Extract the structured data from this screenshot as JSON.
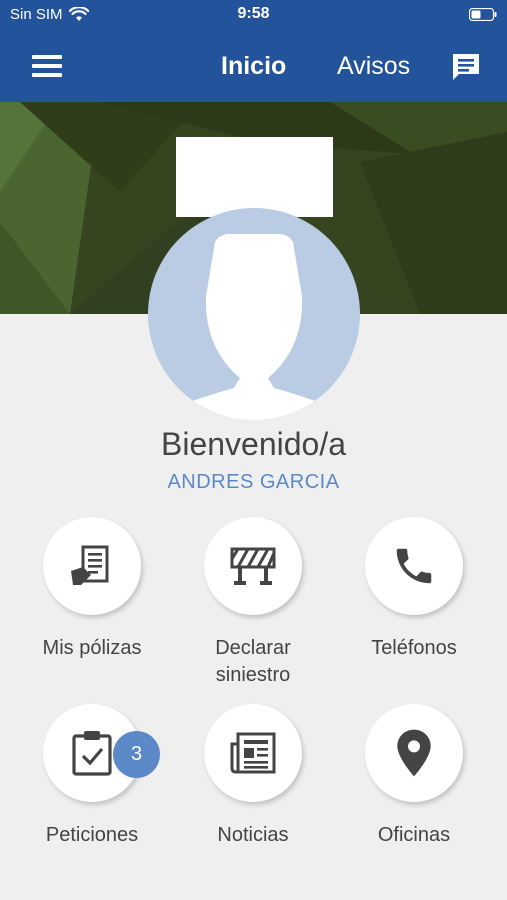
{
  "status_bar": {
    "carrier": "Sin SIM",
    "time": "9:58"
  },
  "nav": {
    "tab_home": "Inicio",
    "tab_notices": "Avisos"
  },
  "profile": {
    "greeting": "Bienvenido/a",
    "user_name": "ANDRES GARCIA"
  },
  "tiles": [
    {
      "label_1": "Mis pólizas",
      "label_2": "",
      "icon": "policy-document-icon"
    },
    {
      "label_1": "Declarar",
      "label_2": "siniestro",
      "icon": "road-barrier-icon"
    },
    {
      "label_1": "Teléfonos",
      "label_2": "",
      "icon": "phone-icon"
    },
    {
      "label_1": "Peticiones",
      "label_2": "",
      "icon": "clipboard-check-icon",
      "badge": "3"
    },
    {
      "label_1": "Noticias",
      "label_2": "",
      "icon": "newspaper-icon"
    },
    {
      "label_1": "Oficinas",
      "label_2": "",
      "icon": "map-pin-icon"
    }
  ],
  "colors": {
    "nav_blue": "#23539a",
    "accent_blue": "#5b89c8",
    "avatar_bg": "#b9cce4",
    "banner_green": "#36451f"
  }
}
